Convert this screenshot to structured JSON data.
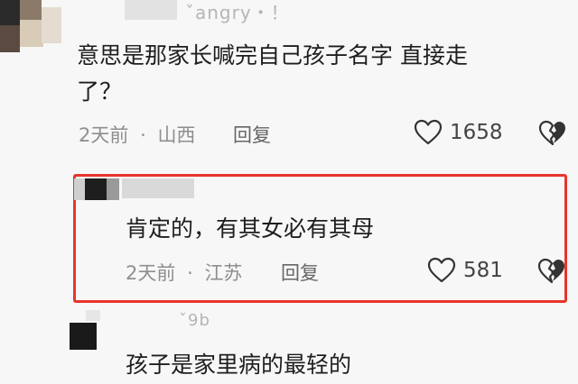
{
  "comments": [
    {
      "username": "ˇangry・！",
      "text_line1": "意思是那家长喊完自己孩子名字 直接走",
      "text_line2": "了？",
      "time": "2天前",
      "location": "山西",
      "reply_label": "回复",
      "likes": "1658",
      "like_icon": "heart-outline-icon",
      "dislike_icon": "broken-heart-icon"
    },
    {
      "username": "",
      "text": "肯定的，有其女必有其母",
      "time": "2天前",
      "location": "江苏",
      "reply_label": "回复",
      "likes": "581",
      "like_icon": "heart-outline-icon",
      "dislike_icon": "broken-heart-icon",
      "highlighted": true,
      "highlight_color": "#e8352b"
    },
    {
      "username": "ˇ9b",
      "text": "孩子是家里病的最轻的"
    }
  ],
  "separator": "·"
}
